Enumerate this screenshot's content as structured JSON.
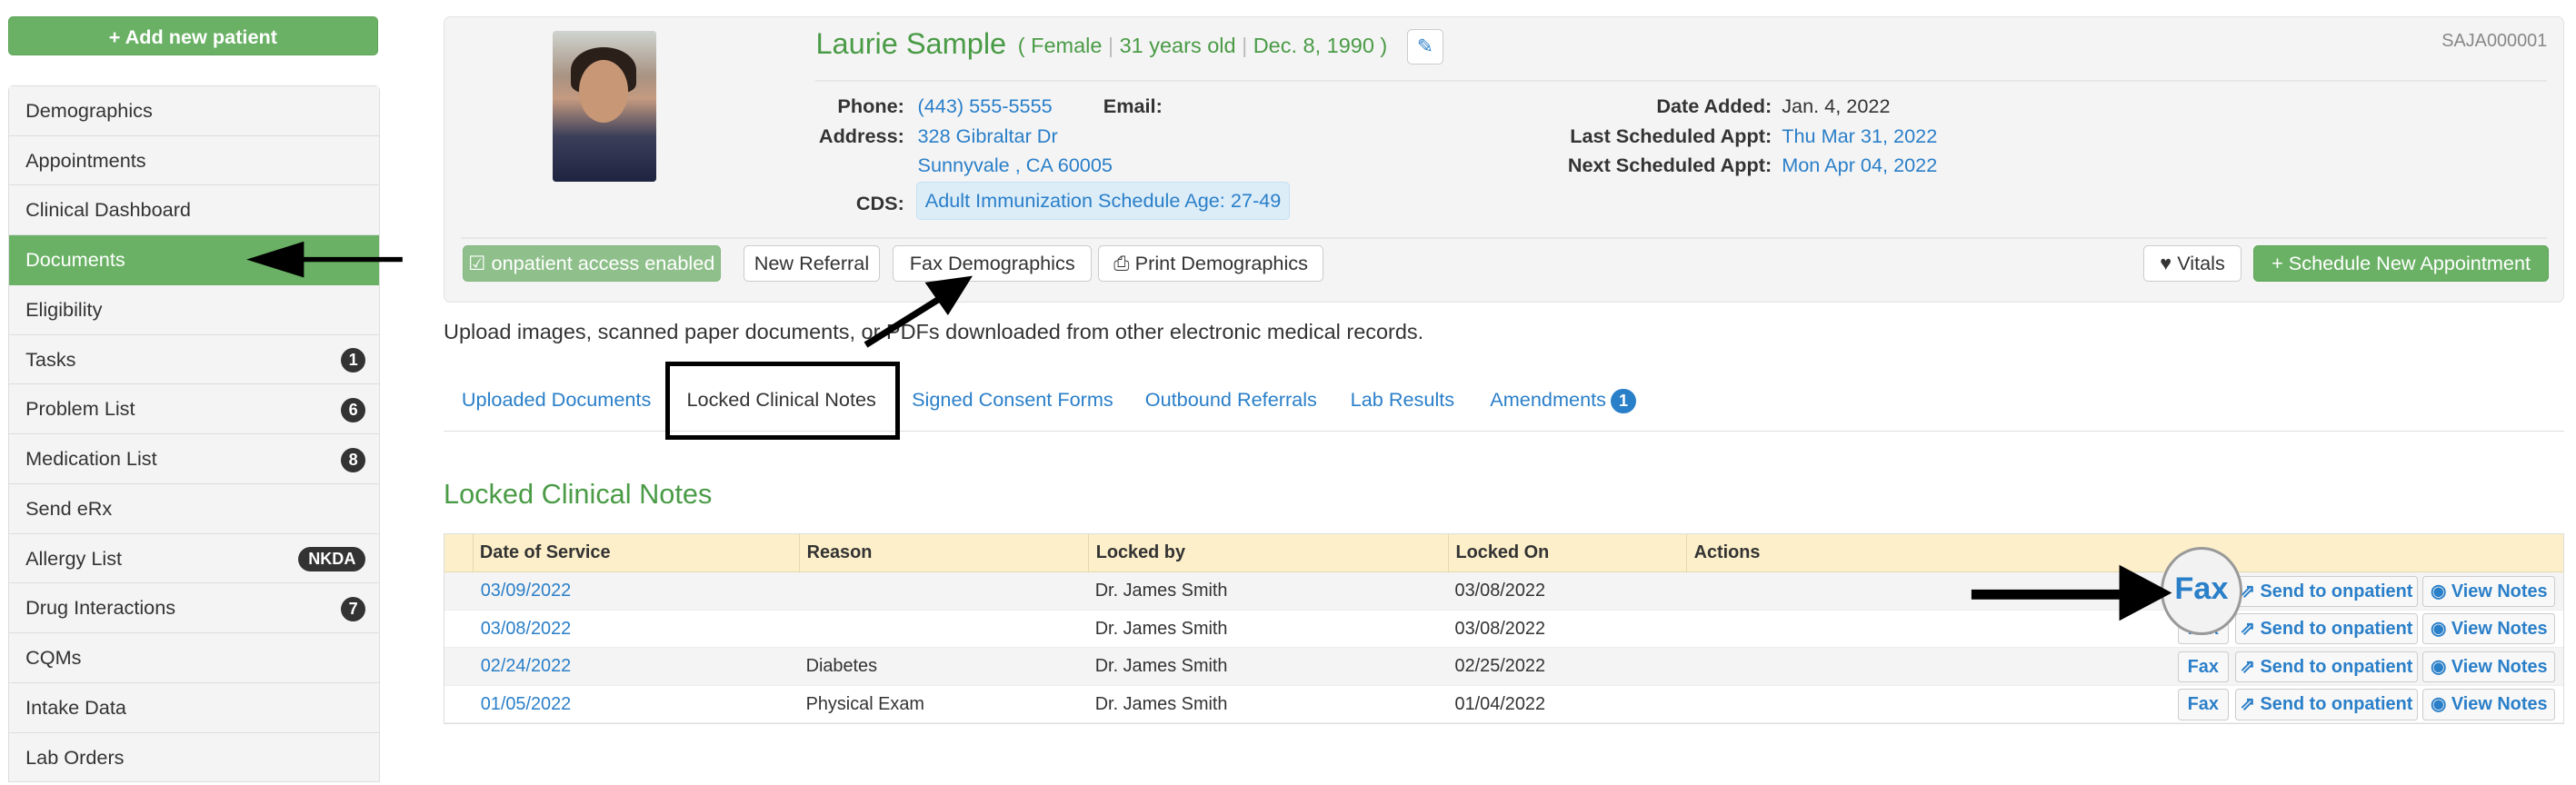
{
  "sidebar": {
    "add_button": "+ Add new patient",
    "items": [
      {
        "label": "Demographics"
      },
      {
        "label": "Appointments"
      },
      {
        "label": "Clinical Dashboard"
      },
      {
        "label": "Documents",
        "active": true
      },
      {
        "label": "Eligibility"
      },
      {
        "label": "Tasks",
        "badge": "1"
      },
      {
        "label": "Problem List",
        "badge": "6"
      },
      {
        "label": "Medication List",
        "badge": "8"
      },
      {
        "label": "Send eRx"
      },
      {
        "label": "Allergy List",
        "badge": "NKDA"
      },
      {
        "label": "Drug Interactions",
        "badge": "7"
      },
      {
        "label": "CQMs"
      },
      {
        "label": "Intake Data"
      },
      {
        "label": "Lab Orders"
      }
    ]
  },
  "patient": {
    "name": "Laurie Sample",
    "sex": "Female",
    "age": "31 years old",
    "dob": "Dec. 8, 1990",
    "mrn": "SAJA000001",
    "phone_label": "Phone:",
    "phone": "(443) 555-5555",
    "email_label": "Email:",
    "address_label": "Address:",
    "address1": "328 Gibraltar Dr",
    "address2": "Sunnyvale , CA 60005",
    "cds_label": "CDS:",
    "cds": "Adult Immunization Schedule Age: 27-49",
    "date_added_label": "Date Added:",
    "date_added": "Jan. 4, 2022",
    "last_appt_label": "Last Scheduled Appt:",
    "last_appt": "Thu Mar 31, 2022",
    "next_appt_label": "Next Scheduled Appt:",
    "next_appt": "Mon Apr 04, 2022"
  },
  "actions": {
    "onpatient": "☑ onpatient access enabled",
    "new_referral": "New Referral",
    "fax_demographics": "Fax Demographics",
    "print_demographics": "Print Demographics",
    "vitals": "Vitals",
    "schedule": "+ Schedule New Appointment"
  },
  "intro": "Upload images, scanned paper documents, or PDFs downloaded from other electronic medical records.",
  "tabs": [
    {
      "label": "Uploaded Documents"
    },
    {
      "label": "Locked Clinical Notes",
      "active": true
    },
    {
      "label": "Signed Consent Forms"
    },
    {
      "label": "Outbound Referrals"
    },
    {
      "label": "Lab Results"
    },
    {
      "label": "Amendments",
      "badge": "1"
    }
  ],
  "section_title": "Locked Clinical Notes",
  "table": {
    "columns": [
      "Date of Service",
      "Reason",
      "Locked by",
      "Locked On",
      "Actions"
    ],
    "rows": [
      {
        "date": "03/09/2022",
        "reason": "",
        "locked_by": "Dr. James Smith",
        "locked_on": "03/08/2022"
      },
      {
        "date": "03/08/2022",
        "reason": "",
        "locked_by": "Dr. James Smith",
        "locked_on": "03/08/2022"
      },
      {
        "date": "02/24/2022",
        "reason": "Diabetes",
        "locked_by": "Dr. James Smith",
        "locked_on": "02/25/2022"
      },
      {
        "date": "01/05/2022",
        "reason": "Physical Exam",
        "locked_by": "Dr. James Smith",
        "locked_on": "01/04/2022"
      }
    ],
    "fax": "Fax",
    "send": "Send to onpatient",
    "view": "View Notes"
  },
  "colors": {
    "brand_green": "#6ab165",
    "link_blue": "#2a7fc9",
    "table_header": "#fcefc9"
  }
}
